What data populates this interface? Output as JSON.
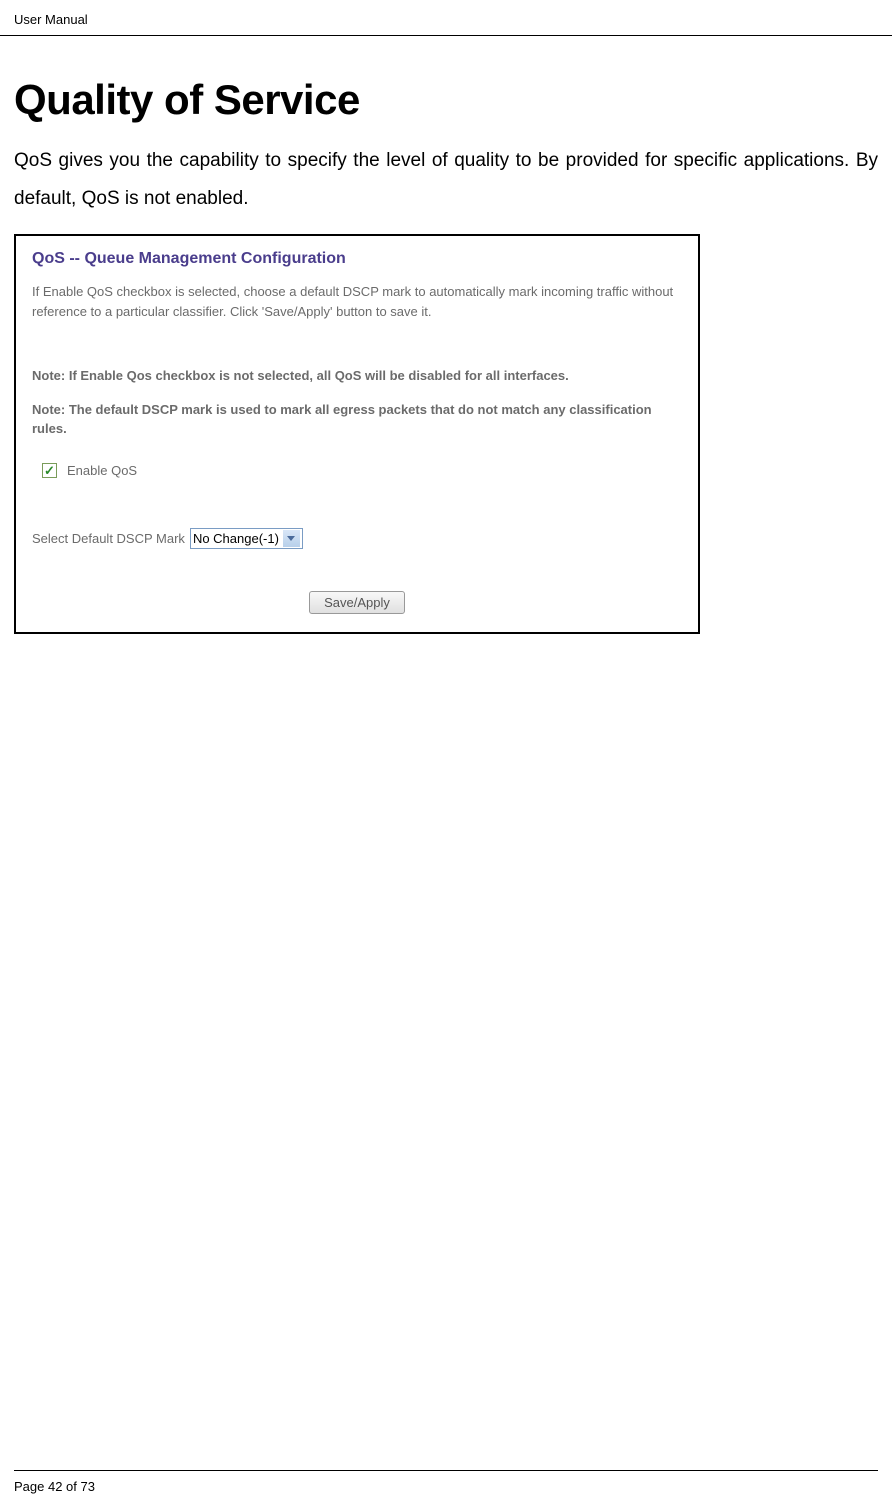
{
  "header": {
    "title": "User Manual"
  },
  "page": {
    "title": "Quality of Service",
    "intro": "QoS gives you the capability to specify the level of quality to be provided for specific applications. By default, QoS is not enabled."
  },
  "config": {
    "title": "QoS -- Queue Management Configuration",
    "description": "If Enable QoS checkbox is selected, choose a default DSCP mark to automatically mark incoming traffic without reference to a particular classifier. Click 'Save/Apply' button to save it.",
    "note1": "Note: If Enable Qos checkbox is not selected, all QoS will be disabled for all interfaces.",
    "note2": "Note: The default DSCP mark is used to mark all egress packets that do not match any classification rules.",
    "checkbox_label": "Enable QoS",
    "select_label": "Select Default DSCP Mark",
    "select_value": "No Change(-1)",
    "save_button": "Save/Apply"
  },
  "footer": {
    "page_info": "Page 42 of 73"
  }
}
